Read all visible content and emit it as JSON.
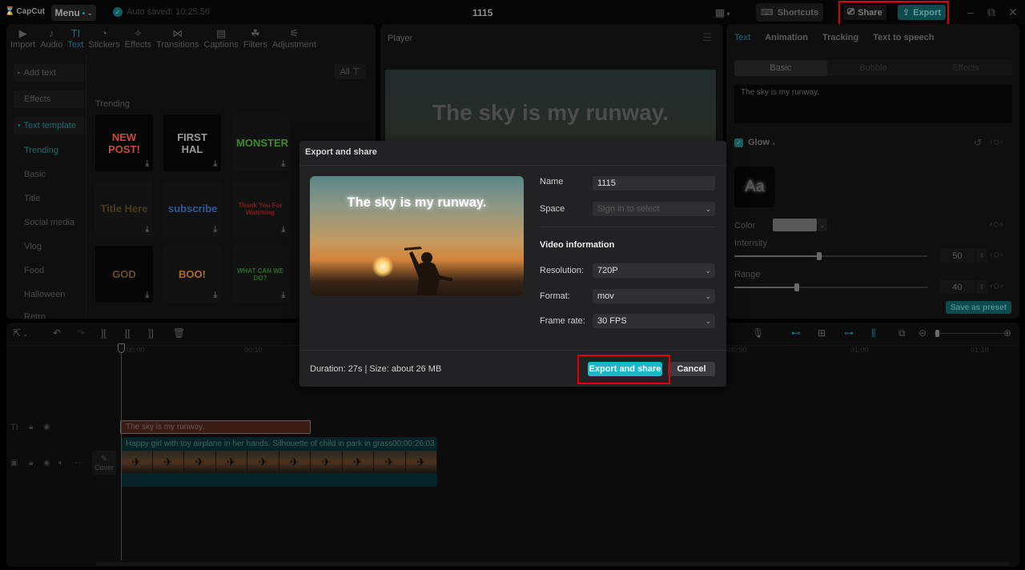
{
  "app": {
    "logo": "CapCut",
    "menu_label": "Menu",
    "autosave": "Auto saved: 10:25:56",
    "project_title": "1115",
    "shortcuts_label": "Shortcuts",
    "share_label": "Share",
    "export_label": "Export"
  },
  "toolbar": {
    "tabs": [
      {
        "label": "Import",
        "icon": "▶"
      },
      {
        "label": "Audio",
        "icon": "♪"
      },
      {
        "label": "Text",
        "icon": "TI",
        "active": true
      },
      {
        "label": "Stickers",
        "icon": "◔"
      },
      {
        "label": "Effects",
        "icon": "✧"
      },
      {
        "label": "Transitions",
        "icon": "⋈"
      },
      {
        "label": "Captions",
        "icon": "▤"
      },
      {
        "label": "Filters",
        "icon": "☘"
      },
      {
        "label": "Adjustment",
        "icon": "⚟"
      }
    ]
  },
  "text_sidebar": {
    "add_text": "Add text",
    "effects": "Effects",
    "text_template": "Text template",
    "categories": [
      "Trending",
      "Basic",
      "Title",
      "Social media",
      "Vlog",
      "Food",
      "Halloween",
      "Retro"
    ]
  },
  "templates": {
    "filter_label": "All",
    "section_title": "Trending",
    "items": [
      {
        "label": "NEW POST!",
        "color": "#c84a3c"
      },
      {
        "label": "FIRST HAL",
        "color": "#9a9a9a"
      },
      {
        "label": "MONSTER",
        "color": "#3e8a2a"
      },
      {
        "label": "Title Here",
        "color": "#4a3a20"
      },
      {
        "label": "subscribe",
        "color": "#2c5a9a"
      },
      {
        "label": "Thank You For Watching",
        "color": "#8a1a1a"
      },
      {
        "label": "GOD",
        "color": "#6a5020"
      },
      {
        "label": "BOO!",
        "color": "#b06a20"
      },
      {
        "label": "WHAT CAN WE DO?",
        "color": "#2c6a2c"
      }
    ]
  },
  "player": {
    "title": "Player",
    "caption": "The sky is my runway."
  },
  "inspector": {
    "tabs": [
      "Text",
      "Animation",
      "Tracking",
      "Text to speech"
    ],
    "active_tab": "Text",
    "subtabs": [
      "Basic",
      "Bubble",
      "Effects"
    ],
    "text_value": "The sky is my runway.",
    "glow_label": "Glow",
    "glow_enabled": true,
    "preview_glyph": "Aa",
    "color_label": "Color",
    "color_value": "#595959",
    "intensity_label": "Intensity",
    "intensity_value": "50",
    "intensity_fraction": 0.5,
    "range_label": "Range",
    "range_value": "40",
    "range_fraction": 0.4,
    "save_preset": "Save as preset"
  },
  "timeline": {
    "ruler": [
      "00:00",
      "00:10",
      "00:50",
      "01:00",
      "01:10"
    ],
    "text_clip": "The sky is my runway.",
    "video_clip_title": "Happy girl with toy airplane in her hands. Silhouette of child in park in grass",
    "video_clip_duration": "00:00:26:03",
    "cover_label": "Cover"
  },
  "dialog": {
    "title": "Export and share",
    "preview_caption": "The sky is my runway.",
    "name_label": "Name",
    "name_value": "1115",
    "space_label": "Space",
    "space_placeholder": "Sign in to select",
    "video_info_heading": "Video information",
    "resolution_label": "Resolution:",
    "resolution_value": "720P",
    "format_label": "Format:",
    "format_value": "mov",
    "framerate_label": "Frame rate:",
    "framerate_value": "30 FPS",
    "summary": "Duration: 27s | Size: about 26 MB",
    "primary_button": "Export and share",
    "cancel_button": "Cancel"
  },
  "colors": {
    "accent": "#18b9c6",
    "highlight": "#e00000"
  }
}
